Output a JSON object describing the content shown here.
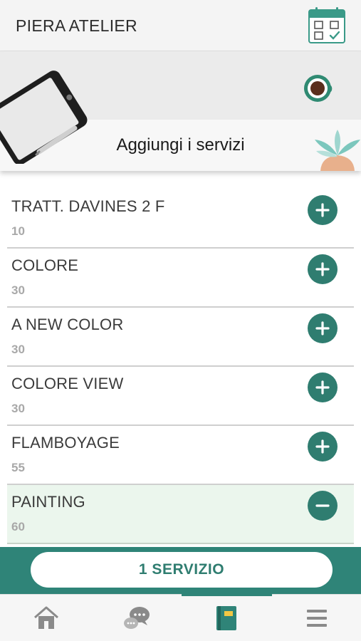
{
  "header": {
    "title": "PIERA ATELIER",
    "calendar_icon": "calendar-check-icon"
  },
  "banner": {
    "title": "Aggiungi i servizi",
    "illustrations": [
      "tablet-illustration",
      "coffee-cup-illustration",
      "plant-illustration"
    ]
  },
  "services": [
    {
      "name": "TRATT. DAVINES 2 F",
      "duration": "10",
      "selected": false,
      "action_icon": "plus-circle-icon"
    },
    {
      "name": "COLORE",
      "duration": "30",
      "selected": false,
      "action_icon": "plus-circle-icon"
    },
    {
      "name": "A NEW COLOR",
      "duration": "30",
      "selected": false,
      "action_icon": "plus-circle-icon"
    },
    {
      "name": "COLORE VIEW",
      "duration": "30",
      "selected": false,
      "action_icon": "plus-circle-icon"
    },
    {
      "name": "FLAMBOYAGE",
      "duration": "55",
      "selected": false,
      "action_icon": "plus-circle-icon"
    },
    {
      "name": "PAINTING",
      "duration": "60",
      "selected": true,
      "action_icon": "minus-circle-icon"
    }
  ],
  "footer": {
    "count_label": "1 SERVIZIO"
  },
  "tabbar": {
    "tabs": [
      {
        "icon": "home-icon",
        "active": false
      },
      {
        "icon": "chat-icon",
        "active": false
      },
      {
        "icon": "booklet-icon",
        "active": true
      },
      {
        "icon": "menu-icon",
        "active": false
      }
    ]
  },
  "colors": {
    "accent": "#2f8478",
    "button": "#2f7d70",
    "selected_row": "#ebf6ed"
  }
}
